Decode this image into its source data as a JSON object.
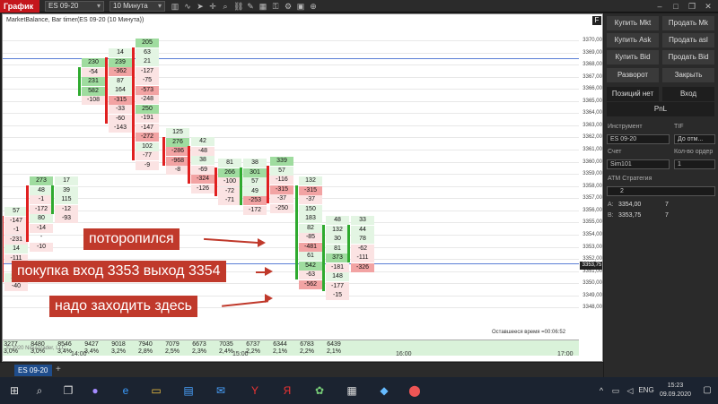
{
  "topbar": {
    "tab_label": "График",
    "instrument": "ES 09-20",
    "timeframe": "10 Минута"
  },
  "chart": {
    "title": "MarketBalance, Bar timer(ES 09-20 (10 Минута))",
    "f_label": "F",
    "current_price": "3353,75",
    "remaining_label": "Оставшееся время =00:06:52",
    "copyright": "© 2020 NinjaTrader, LLC",
    "x_ticks": [
      "14:00",
      "15:00",
      "16:00",
      "17:00"
    ],
    "y_ticks": [
      "3370,00",
      "3369,00",
      "3368,00",
      "3367,00",
      "3366,00",
      "3365,00",
      "3364,00",
      "3363,00",
      "3362,00",
      "3361,00",
      "3360,00",
      "3359,00",
      "3358,00",
      "3357,00",
      "3356,00",
      "3355,00",
      "3354,00",
      "3353,00",
      "3352,00",
      "3351,00",
      "3350,00",
      "3349,00",
      "3348,00"
    ],
    "volumes": [
      "3277",
      "8480",
      "8546",
      "9427",
      "9018",
      "7940",
      "7079",
      "6673",
      "7035",
      "6737",
      "6344",
      "6783",
      "6439"
    ],
    "percents": [
      "3,0%",
      "3,0%",
      "3,4%",
      "3,4%",
      "3,2%",
      "2,8%",
      "2,5%",
      "2,3%",
      "2,4%",
      "2,2%",
      "2,1%",
      "2,2%",
      "2,1%"
    ],
    "columns": [
      {
        "cells": [
          "57",
          "-147",
          "-1",
          "-231",
          "14",
          "-111",
          "-",
          "155",
          "-40"
        ]
      },
      {
        "cells": [
          "273",
          "48",
          "-1",
          "-172",
          "80",
          "-14",
          "-",
          "-10"
        ]
      },
      {
        "cells": [
          "17",
          "39",
          "115",
          "-12",
          "-93"
        ]
      },
      {
        "cells": [
          "230",
          "-54",
          "231",
          "582",
          "-108"
        ]
      },
      {
        "cells": [
          "14",
          "239",
          "-362",
          "87",
          "164",
          "-315",
          "-33",
          "-60",
          "-143"
        ]
      },
      {
        "cells": [
          "205",
          "63",
          "21",
          "-127",
          "-75",
          "-573",
          "-248",
          "250",
          "-191",
          "-147",
          "-272",
          "102",
          "-77",
          "-9"
        ]
      },
      {
        "cells": [
          "125",
          "276",
          "-286",
          "-968",
          "-8"
        ]
      },
      {
        "cells": [
          "42",
          "-48",
          "38",
          "-69",
          "-324",
          "-126"
        ]
      },
      {
        "cells": [
          "81",
          "266",
          "-100",
          "-72",
          "-71"
        ]
      },
      {
        "cells": [
          "38",
          "301",
          "57",
          "49",
          "-253",
          "-172"
        ]
      },
      {
        "cells": [
          "339",
          "57",
          "-116",
          "-315",
          "-37",
          "-250"
        ]
      },
      {
        "cells": [
          "132",
          "-315",
          "-37",
          "150",
          "183",
          "82",
          "-85",
          "-481",
          "61",
          "542",
          "-63",
          "-562"
        ]
      },
      {
        "cells": [
          "48",
          "132",
          "30",
          "81",
          "373",
          "-181",
          "148",
          "-177",
          "-15"
        ]
      },
      {
        "cells": [
          "33",
          "44",
          "78",
          "-62",
          "-111",
          "-326"
        ]
      }
    ]
  },
  "annotations": [
    "поторопился",
    "покупка вход 3353 выход 3354",
    "надо заходить здесь"
  ],
  "bottom_tab": "ES 09-20",
  "panel": {
    "buttons": [
      "Купить Mkt",
      "Продать Mk",
      "Купить Ask",
      "Продать asl",
      "Купить Bid",
      "Продать Bid",
      "Разворот",
      "Закрыть"
    ],
    "position_label": "Позиций нет",
    "entry_label": "Вход",
    "pnl_label": "PnL",
    "instrument_label": "Инструмент",
    "instrument_value": "ES 09-20",
    "tif_label": "TIF",
    "tif_value": "До отм...",
    "account_label": "Счет",
    "account_value": "Sim101",
    "qty_label": "Кол-во ордер",
    "qty_value": "1",
    "atm_label": "ATM Стратегия",
    "atm_value": "2",
    "a_label": "A:",
    "a_price": "3354,00",
    "a_size": "7",
    "b_label": "B:",
    "b_price": "3353,75",
    "b_size": "7"
  },
  "taskbar": {
    "time": "15:23",
    "date": "09.09.2020",
    "lang": "ENG"
  }
}
